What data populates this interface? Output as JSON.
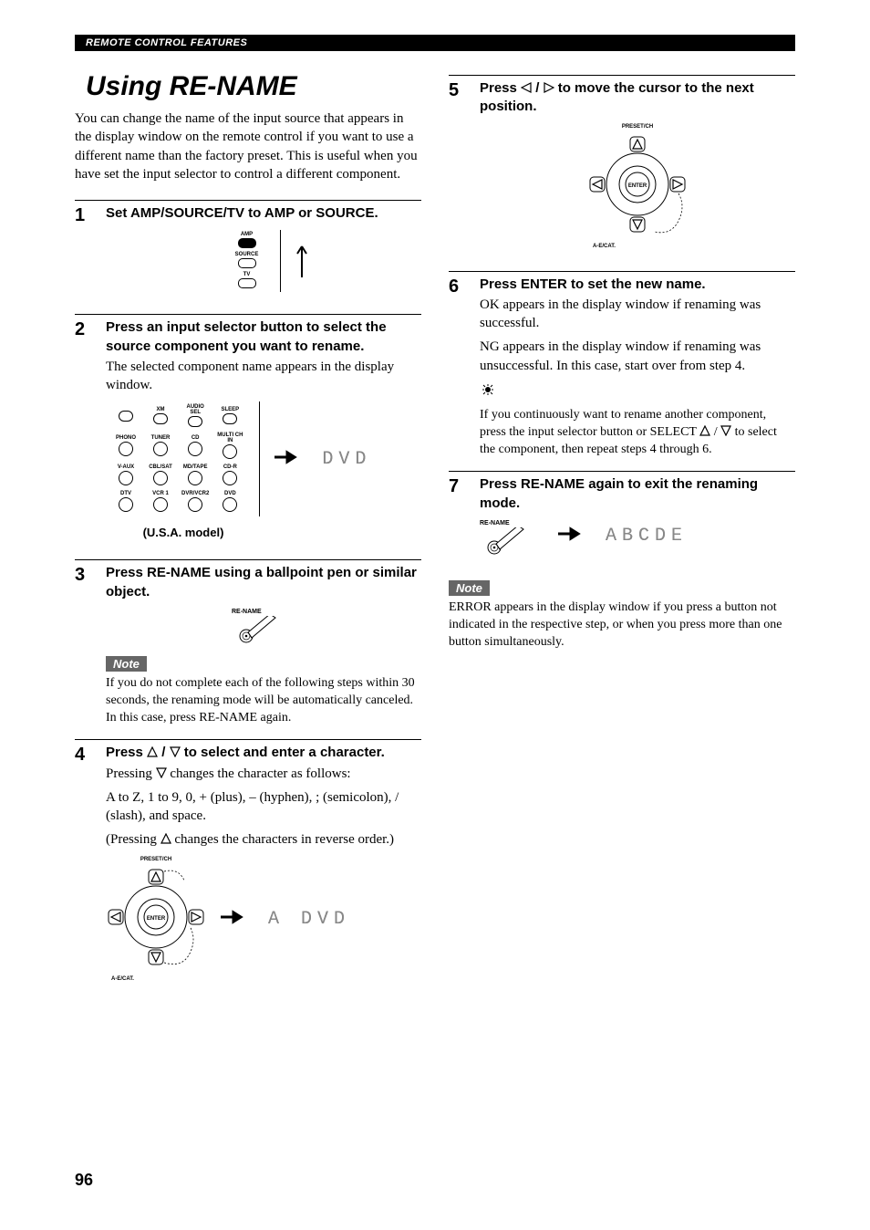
{
  "header": "REMOTE CONTROL FEATURES",
  "title": "Using RE-NAME",
  "intro": "You can change the name of the input source that appears in the display window on the remote control if you want to use a different name than the factory preset. This is useful when you have set the input selector to control a different component.",
  "page_number": "96",
  "steps": {
    "s1": {
      "num": "1",
      "heading": "Set AMP/SOURCE/TV to AMP or SOURCE."
    },
    "s2": {
      "num": "2",
      "heading": "Press an input selector button to select the source component you want to rename.",
      "text": "The selected component name appears in the display window.",
      "model_caption": "(U.S.A. model)",
      "lcd": "  DVD "
    },
    "s3": {
      "num": "3",
      "heading": "Press RE-NAME using a ballpoint pen or similar object.",
      "note_label": "Note",
      "note_text": "If you do not complete each of the following steps within 30 seconds, the renaming mode will be automatically canceled. In this case, press RE-NAME again.",
      "btn_label": "RE-NAME"
    },
    "s4": {
      "num": "4",
      "heading_a": "Press ",
      "heading_b": " / ",
      "heading_c": " to select and enter a character.",
      "line1a": "Pressing ",
      "line1b": " changes the character as follows:",
      "line2": "A to Z, 1 to 9, 0, + (plus), – (hyphen), ; (semicolon), / (slash), and space.",
      "line3a": "(Pressing ",
      "line3b": " changes the characters in reverse order.)",
      "dpad_top": "PRESET/CH",
      "dpad_bot": "A-E/CAT.",
      "dpad_center": "ENTER",
      "lcd": "A DVD"
    },
    "s5": {
      "num": "5",
      "heading_a": "Press ",
      "heading_b": " / ",
      "heading_c": " to move the cursor to the next position.",
      "dpad_top": "PRESET/CH",
      "dpad_bot": "A-E/CAT.",
      "dpad_center": "ENTER"
    },
    "s6": {
      "num": "6",
      "heading": "Press ENTER to set the new name.",
      "text1": "OK appears in the display window if renaming was successful.",
      "text2": "NG appears in the display window if renaming was unsuccessful. In this case, start over from step 4.",
      "tip_a": "If you continuously want to rename another component, press the input selector button or SELECT ",
      "tip_b": " / ",
      "tip_c": " to select the component, then repeat steps 4 through 6."
    },
    "s7": {
      "num": "7",
      "heading": "Press RE-NAME again to exit the renaming mode.",
      "btn_label": "RE-NAME",
      "lcd": "ABCDE"
    }
  },
  "right_note": {
    "label": "Note",
    "text": "ERROR appears in the display window if you press a button not indicated in the respective step, or when you press more than one button simultaneously."
  },
  "sel_switch": {
    "amp": "AMP",
    "source": "SOURCE",
    "tv": "TV"
  },
  "buttons_grid": {
    "r0": [
      "",
      "XM",
      "AUDIO SEL",
      "SLEEP"
    ],
    "r1": [
      "PHONO",
      "TUNER",
      "CD",
      "MULTI CH IN"
    ],
    "r2": [
      "V-AUX",
      "CBL/SAT",
      "MD/TAPE",
      "CD-R"
    ],
    "r3": [
      "DTV",
      "VCR 1",
      "DVR/VCR2",
      "DVD"
    ]
  }
}
